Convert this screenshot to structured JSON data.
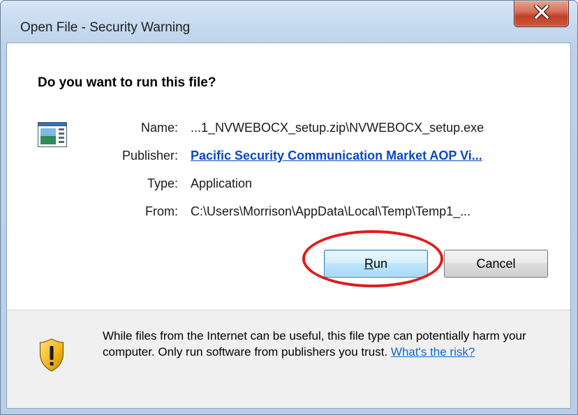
{
  "window": {
    "title": "Open File - Security Warning",
    "close_glyph": "x"
  },
  "dialog": {
    "question": "Do you want to run this file?",
    "file_icon": "application-icon",
    "fields": [
      {
        "label": "Name:",
        "value": "...1_NVWEBOCX_setup.zip\\NVWEBOCX_setup.exe"
      },
      {
        "label": "Publisher:",
        "value": "Pacific Security Communication Market AOP Vi..."
      },
      {
        "label": "Type:",
        "value": "Application"
      },
      {
        "label": "From:",
        "value": "C:\\Users\\Morrison\\AppData\\Local\\Temp\\Temp1_..."
      }
    ]
  },
  "buttons": {
    "run_first": "R",
    "run_rest": "un",
    "cancel": "Cancel"
  },
  "footer": {
    "icon": "shield-warning-icon",
    "warning_text": "While files from the Internet can be useful, this file type can potentially harm your computer. Only run software from publishers you trust.",
    "link": "What's the risk?"
  },
  "colors": {
    "link": "#0a47c9",
    "highlight": "#e21b1b",
    "close_button": "#c0402a"
  }
}
